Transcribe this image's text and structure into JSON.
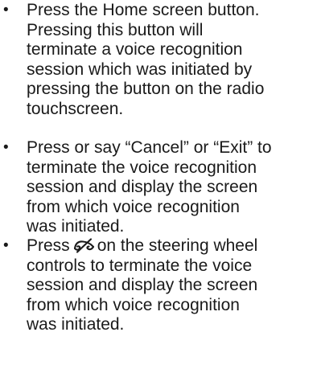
{
  "bullets": [
    {
      "marker": "•",
      "lines": [
        "Press the Home screen button.",
        "Pressing this button will",
        "terminate a voice recognition",
        "session which was initiated by",
        "pressing the button on the radio",
        "touchscreen."
      ]
    },
    {
      "marker": "•",
      "lines": [
        "Press or say “Cancel” or “Exit” to",
        "terminate the voice recognition",
        "session and display the screen",
        "from which voice recognition",
        "was initiated."
      ]
    },
    {
      "marker": "•",
      "line1_before_icon": "Press",
      "icon": "end-voice-session-icon",
      "line1_after_icon": "on the steering wheel",
      "lines": [
        "controls to terminate the voice",
        "session and display the screen",
        "from which voice recognition",
        "was initiated."
      ]
    }
  ]
}
